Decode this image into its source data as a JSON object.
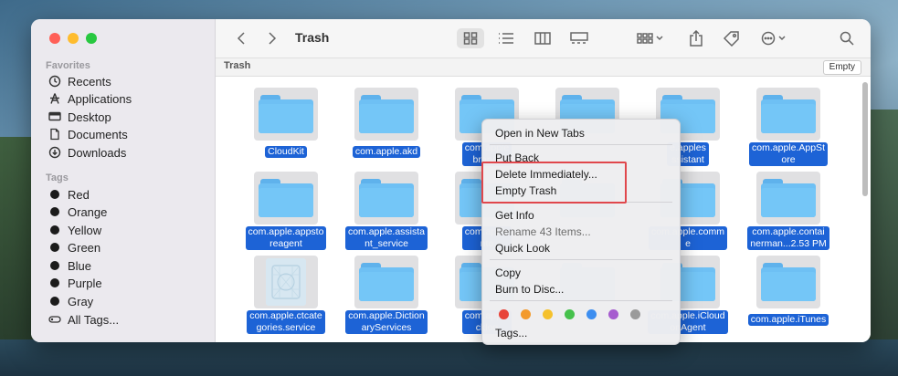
{
  "window": {
    "title": "Trash"
  },
  "sidebar": {
    "favorites_heading": "Favorites",
    "favorites": [
      {
        "label": "Recents",
        "icon": "clock-icon"
      },
      {
        "label": "Applications",
        "icon": "applications-icon"
      },
      {
        "label": "Desktop",
        "icon": "desktop-icon"
      },
      {
        "label": "Documents",
        "icon": "document-icon"
      },
      {
        "label": "Downloads",
        "icon": "download-icon"
      }
    ],
    "tags_heading": "Tags",
    "tags": [
      {
        "label": "Red"
      },
      {
        "label": "Orange"
      },
      {
        "label": "Yellow"
      },
      {
        "label": "Green"
      },
      {
        "label": "Blue"
      },
      {
        "label": "Purple"
      },
      {
        "label": "Gray"
      },
      {
        "label": "All Tags...",
        "icon": "all-tags-icon"
      }
    ]
  },
  "pathbar": {
    "label": "Trash",
    "empty_button": "Empty"
  },
  "items": [
    "CloudKit",
    "com.apple.akd",
    "com.apple\nbraryA",
    "",
    "e.apples\nssistant",
    "com.apple.AppSt\nore",
    "com.apple.appsto\nreagent",
    "com.apple.assista\nnt_service",
    "com.apple\nnto",
    "",
    "com.apple.comm\ne",
    "com.apple.contai\nnerman...2.53 PM",
    "com.apple.ctcate\ngories.service",
    "com.apple.Diction\naryServices",
    "com.apple\ncklog",
    "",
    "com.apple.iCloud\nonAgent",
    "com.apple.iTunes"
  ],
  "context_menu": {
    "open_new_tabs": "Open in New Tabs",
    "put_back": "Put Back",
    "delete_immediately": "Delete Immediately...",
    "empty_trash": "Empty Trash",
    "get_info": "Get Info",
    "rename": "Rename 43 Items...",
    "quick_look": "Quick Look",
    "copy": "Copy",
    "burn": "Burn to Disc...",
    "tags": "Tags...",
    "tag_colors": [
      "#e8443a",
      "#f39a2b",
      "#f5c12c",
      "#46c14c",
      "#3d8ef0",
      "#a65ccf",
      "#9a9a9a"
    ]
  },
  "colors": {
    "selection": "#1d63d6",
    "folder": "#6ec0f4",
    "highlight": "#e0474c"
  }
}
